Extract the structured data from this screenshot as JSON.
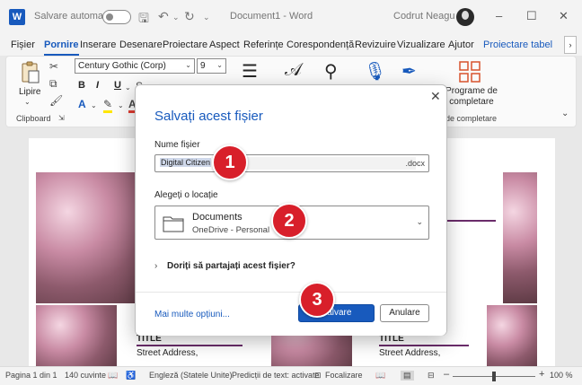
{
  "titlebar": {
    "autosave_label": "Salvare automată",
    "doc_title": "Document1  -  Word",
    "user_name": "Codrut Neagu",
    "logo_letter": "W",
    "minimize": "–",
    "maximize": "☐",
    "close": "✕"
  },
  "tabs": [
    "Fișier",
    "Pornire",
    "Inserare",
    "Desenare",
    "Proiectare",
    "Aspect",
    "Referințe",
    "Corespondență",
    "Revizuire",
    "Vizualizare",
    "Ajutor",
    "Proiectare tabel"
  ],
  "ribbon": {
    "paste_label": "Lipire",
    "clipboard_label": "Clipboard",
    "font_name": "Century Gothic (Corp)",
    "font_size": "9",
    "bold": "B",
    "italic": "I",
    "underline": "U",
    "styles_group_label": "rame de completare",
    "programs_label": "Programe de completare"
  },
  "document": {
    "card_title": "TITLE",
    "card_address": "Street Address,"
  },
  "dialog": {
    "title": "Salvați acest fișier",
    "filename_label": "Nume fișier",
    "filename_value": "Digital Citizen",
    "filename_ext": ".docx",
    "location_label": "Alegeți o locație",
    "location_name": "Documents",
    "location_sub": "OneDrive - Personal",
    "share_label": "Doriți să partajați acest fișier?",
    "more_options": "Mai multe opțiuni...",
    "save_button": "Salvare",
    "cancel_button": "Anulare"
  },
  "badges": [
    "1",
    "2",
    "3"
  ],
  "statusbar": {
    "page": "Pagina 1 din 1",
    "words": "140 cuvinte",
    "language": "Engleză (Statele Unite)",
    "predictions": "Predicții de text: activate",
    "focus": "Focalizare",
    "zoom_minus": "–",
    "zoom_plus": "+",
    "zoom_level": "100 %"
  },
  "colors": {
    "accent": "#185abd",
    "badge": "#d81f2a",
    "title_rule": "#6a2c6a"
  }
}
